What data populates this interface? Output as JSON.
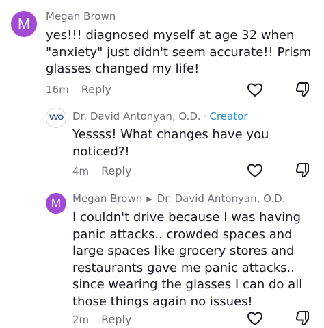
{
  "comments": [
    {
      "avatar_letter": "M",
      "author": "Megan Brown",
      "text": "yes!!! diagnosed myself at age 32 when \"anxiety\" just didn't seem accurate!! Prism glasses changed my life!",
      "time": "16m",
      "reply_label": "Reply"
    },
    {
      "avatar_text": "VVO",
      "author": "Dr. David Antonyan, O.D.",
      "separator": "·",
      "creator_label": "Creator",
      "text": "Yessss! What changes have you noticed?!",
      "time": "4m",
      "reply_label": "Reply"
    },
    {
      "avatar_letter": "M",
      "author": "Megan Brown",
      "reply_to": "Dr. David Antonyan, O.D.",
      "text": "I couldn't drive because I was having panic attacks.. crowded spaces and large spaces like grocery stores and restaurants gave me panic attacks.. since wearing the glasses I can do all those things again no issues!",
      "time": "2m",
      "reply_label": "Reply"
    }
  ],
  "icons": {
    "like": "heart-outline-icon",
    "dislike": "thumbs-down-outline-icon"
  },
  "colors": {
    "avatar_purple": "#a14ad6",
    "creator_blue": "#2a8fd6",
    "meta_gray": "#6f7077"
  }
}
